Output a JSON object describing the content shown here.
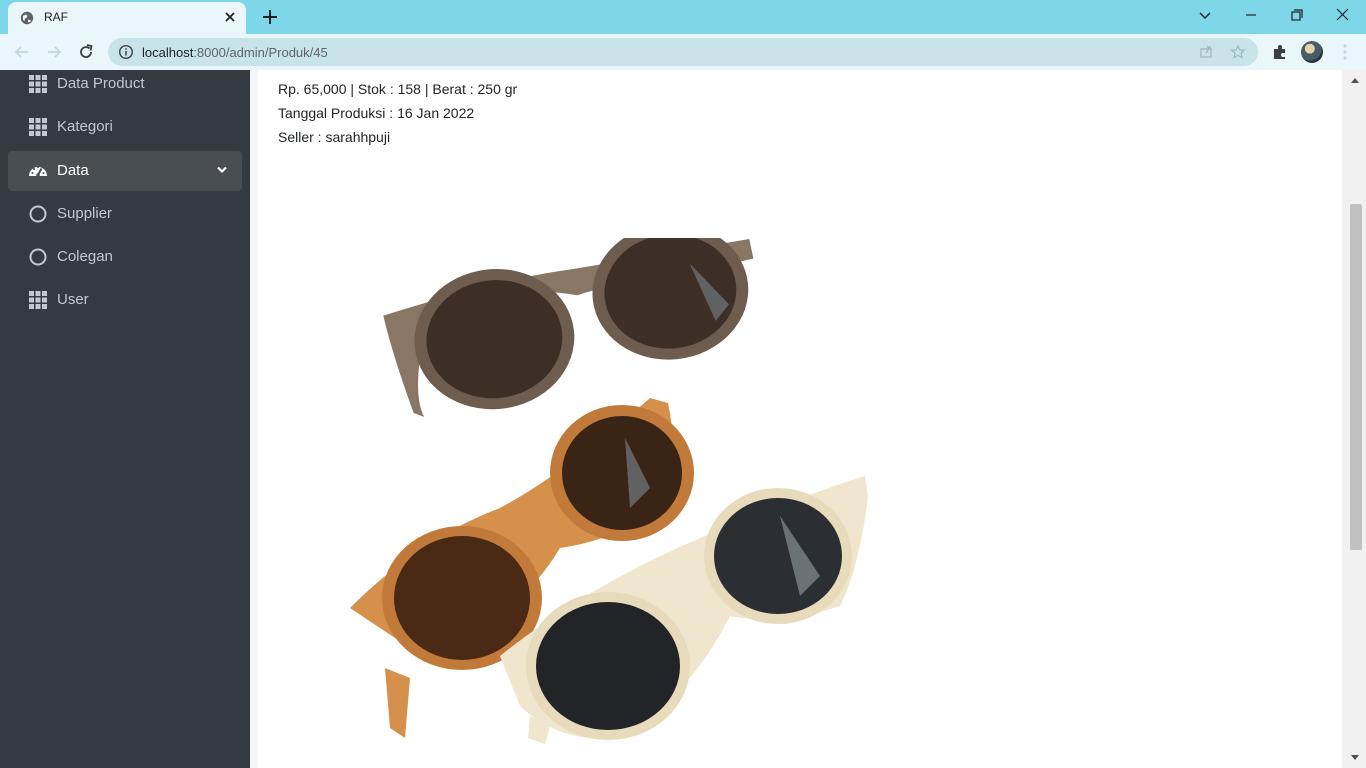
{
  "browser": {
    "tab_title": "RAF",
    "url_host": "localhost",
    "url_rest": ":8000/admin/Produk/45"
  },
  "sidebar": {
    "items": [
      {
        "label": "Data Product",
        "icon": "grid-icon"
      },
      {
        "label": "Kategori",
        "icon": "grid-icon"
      },
      {
        "label": "Data",
        "icon": "tachometer-icon",
        "active": true
      },
      {
        "label": "Supplier",
        "icon": "circle-icon"
      },
      {
        "label": "Colegan",
        "icon": "circle-icon"
      },
      {
        "label": "User",
        "icon": "grid-icon"
      }
    ]
  },
  "product": {
    "price_line": "Rp. 65,000 | Stok : 158 | Berat : 250 gr",
    "production_date": "Tanggal Produksi : 16 Jan 2022",
    "seller": "Seller : sarahhpuji"
  },
  "colors": {
    "sidebar_bg": "#343a40",
    "active_item_bg": "#494e53",
    "chrome_tabbar": "#7ed7e8",
    "chrome_toolbar": "#e9f6fa"
  }
}
